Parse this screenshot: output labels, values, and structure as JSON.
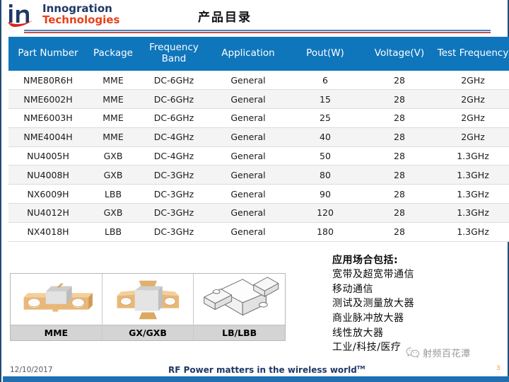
{
  "header": {
    "logo": {
      "mark": "in-logo-icon",
      "line1": "Innogration",
      "line2": "Technologies",
      "color_blue": "#1f3864",
      "color_red": "#e8421a"
    },
    "title": "产品目录",
    "rule_blue_color": "#4f81bd",
    "rule_red_color": "#c0504d"
  },
  "table": {
    "header_bg": "#0f76bc",
    "columns": [
      "Part Number",
      "Package",
      "Frequency Band",
      "Application",
      "Pout(W)",
      "Voltage(V)",
      "Test Frequency"
    ],
    "columns_wrapped": [
      [
        "Part Number"
      ],
      [
        "Package"
      ],
      [
        "Frequency",
        "Band"
      ],
      [
        "Application"
      ],
      [
        "Pout(W)"
      ],
      [
        "Voltage(V)"
      ],
      [
        "Test Frequency"
      ]
    ],
    "rows": [
      [
        "NME80R6H",
        "MME",
        "DC-6GHz",
        "General",
        "6",
        "28",
        "2GHz"
      ],
      [
        "NME6002H",
        "MME",
        "DC-6GHz",
        "General",
        "15",
        "28",
        "2GHz"
      ],
      [
        "NME6003H",
        "MME",
        "DC-6GHz",
        "General",
        "25",
        "28",
        "2GHz"
      ],
      [
        "NME4004H",
        "MME",
        "DC-4GHz",
        "General",
        "40",
        "28",
        "2GHz"
      ],
      [
        "NU4005H",
        "GXB",
        "DC-4GHz",
        "General",
        "50",
        "28",
        "1.3GHz"
      ],
      [
        "NU4008H",
        "GXB",
        "DC-3GHz",
        "General",
        "80",
        "28",
        "1.3GHz"
      ],
      [
        "NX6009H",
        "LBB",
        "DC-3GHz",
        "General",
        "90",
        "28",
        "1.3GHz"
      ],
      [
        "NU4012H",
        "GXB",
        "DC-3GHz",
        "General",
        "120",
        "28",
        "1.3GHz"
      ],
      [
        "NX4018H",
        "LBB",
        "DC-3GHz",
        "General",
        "180",
        "28",
        "1.3GHz"
      ]
    ]
  },
  "packages": [
    {
      "label": "MME",
      "label_bold": "MME",
      "label_rest": "",
      "image": "rf-package-mme-photo"
    },
    {
      "label": "GX/GXB",
      "label_bold": "GX/GXB",
      "label_rest": "",
      "image": "rf-package-gxb-photo"
    },
    {
      "label": "LB/LBB",
      "label_bold": "LB",
      "label_rest": "/LBB",
      "image": "rf-package-lbb-drawing"
    }
  ],
  "applications": {
    "heading": "应用场合包括:",
    "items": [
      "宽带及超宽带通信",
      "移动通信",
      "测试及测量放大器",
      "商业脉冲放大器",
      "线性放大器",
      "工业/科技/医疗"
    ]
  },
  "footer": {
    "date": "12/10/2017",
    "tagline": "RF Power matters in the wireless world",
    "tagline_tm": "TM",
    "page_number": "3",
    "bar_color": "#1f6fb2"
  },
  "watermark": {
    "icon": "wechat-icon",
    "text": "射频百花潭"
  }
}
